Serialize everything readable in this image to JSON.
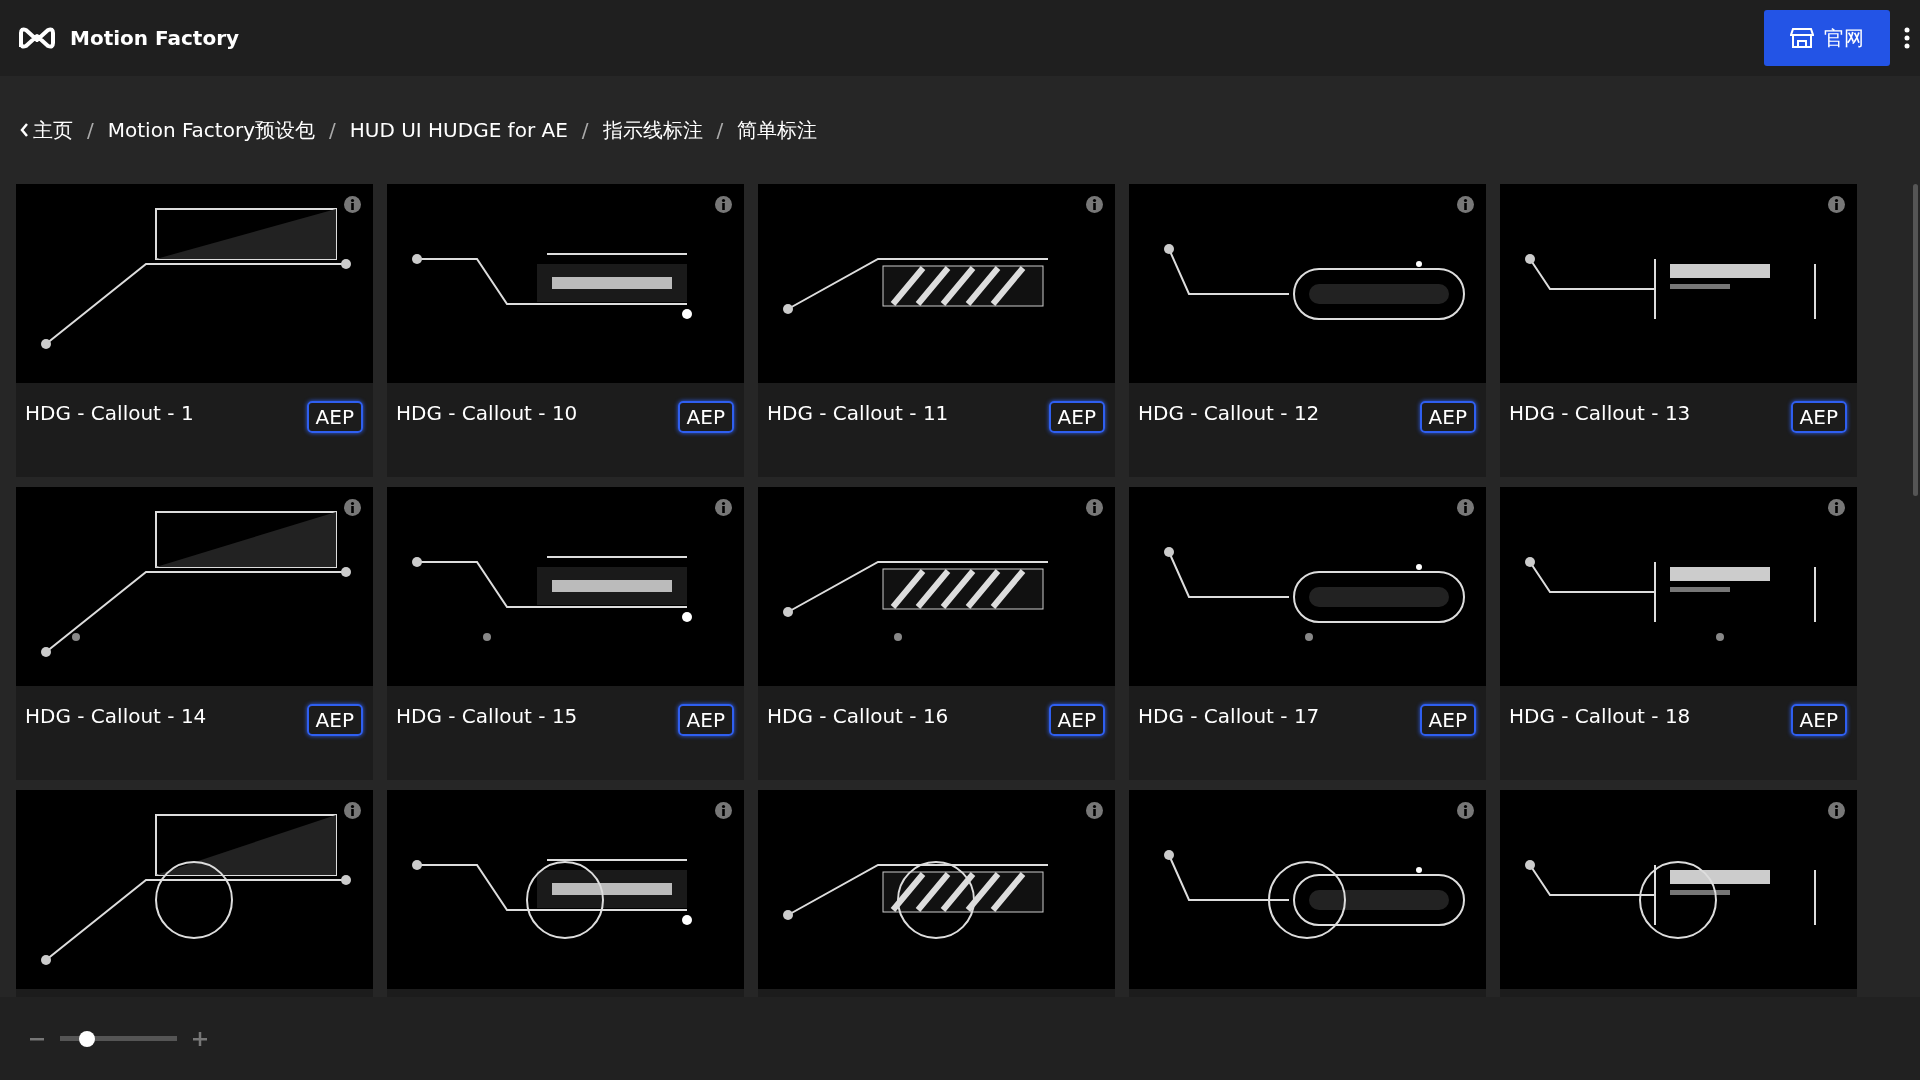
{
  "header": {
    "app_name": "Motion Factory",
    "site_button": "官网"
  },
  "breadcrumb": {
    "separator": "/",
    "items": [
      {
        "label": "主页"
      },
      {
        "label": "Motion Factory预设包"
      },
      {
        "label": "HUD UI HUDGE for AE"
      },
      {
        "label": "指示线标注"
      },
      {
        "label": "简单标注"
      }
    ]
  },
  "cards": [
    {
      "kind": "picture",
      "title": "HDG - Callout - 1",
      "badge": "AEP"
    },
    {
      "kind": "picture",
      "title": "HDG - Callout - 10",
      "badge": "AEP"
    },
    {
      "kind": "picture",
      "title": "HDG - Callout - 11",
      "badge": "AEP"
    },
    {
      "kind": "picture",
      "title": "HDG - Callout - 12",
      "badge": "AEP"
    },
    {
      "kind": "picture",
      "title": "HDG - Callout - 13",
      "badge": "AEP"
    },
    {
      "kind": "picture",
      "title": "HDG - Callout - 14",
      "badge": "AEP"
    },
    {
      "kind": "picture",
      "title": "HDG - Callout - 15",
      "badge": "AEP"
    },
    {
      "kind": "picture",
      "title": "HDG - Callout - 16",
      "badge": "AEP"
    },
    {
      "kind": "picture",
      "title": "HDG - Callout - 17",
      "badge": "AEP"
    },
    {
      "kind": "picture",
      "title": "HDG - Callout - 18",
      "badge": "AEP"
    },
    {
      "kind": "picture"
    },
    {
      "kind": "picture"
    },
    {
      "kind": "picture"
    },
    {
      "kind": "picture"
    },
    {
      "kind": "picture"
    }
  ],
  "zoom_slider": {
    "level": 0.23
  }
}
